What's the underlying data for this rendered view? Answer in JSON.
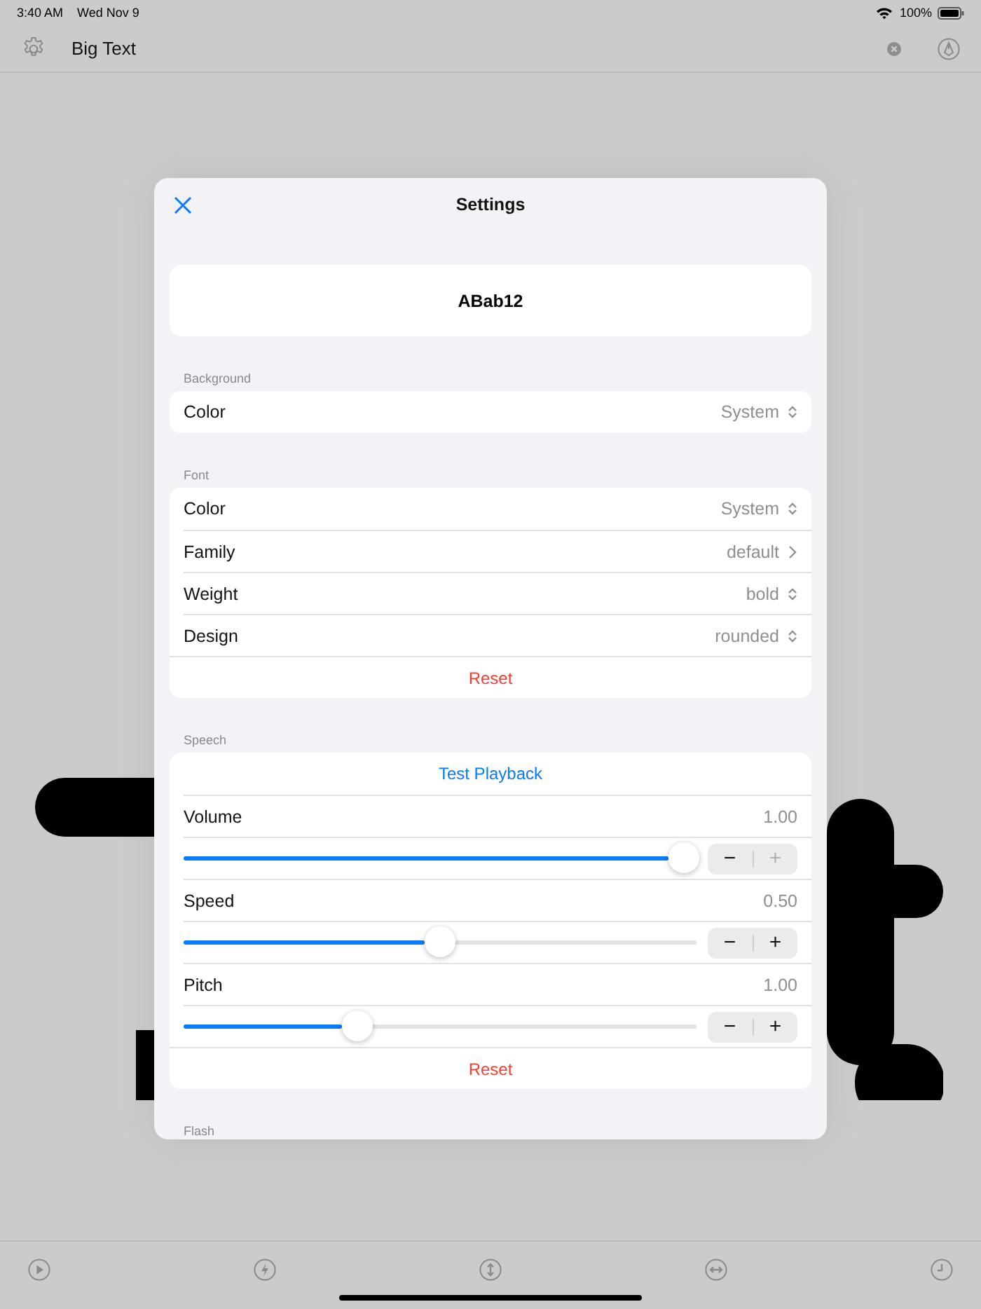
{
  "status_bar": {
    "time": "3:40 AM",
    "date": "Wed Nov 9",
    "battery": "100%"
  },
  "nav_bar": {
    "title": "Big Text"
  },
  "sheet": {
    "title": "Settings",
    "preview": "ABab12",
    "sections": [
      {
        "header": "Background",
        "rows": [
          {
            "kind": "picker",
            "label": "Color",
            "value": "System"
          }
        ]
      },
      {
        "header": "Font",
        "rows": [
          {
            "kind": "picker",
            "label": "Color",
            "value": "System"
          },
          {
            "kind": "link",
            "label": "Family",
            "value": "default"
          },
          {
            "kind": "picker",
            "label": "Weight",
            "value": "bold"
          },
          {
            "kind": "picker",
            "label": "Design",
            "value": "rounded"
          },
          {
            "kind": "reset",
            "label": "Reset"
          }
        ]
      },
      {
        "header": "Speech",
        "rows": [
          {
            "kind": "playback",
            "label": "Test Playback"
          },
          {
            "kind": "value",
            "label": "Volume",
            "value": "1.00"
          },
          {
            "kind": "slider",
            "level": 0.975,
            "minus": "−",
            "plus": "+",
            "minus_disabled": false,
            "plus_disabled": true
          },
          {
            "kind": "value",
            "label": "Speed",
            "value": "0.50"
          },
          {
            "kind": "slider",
            "level": 0.5,
            "minus": "−",
            "plus": "+",
            "minus_disabled": false,
            "plus_disabled": false
          },
          {
            "kind": "value",
            "label": "Pitch",
            "value": "1.00"
          },
          {
            "kind": "slider",
            "level": 0.34,
            "minus": "−",
            "plus": "+",
            "minus_disabled": false,
            "plus_disabled": false
          },
          {
            "kind": "reset",
            "label": "Reset"
          }
        ]
      },
      {
        "header": "Flash"
      }
    ]
  }
}
